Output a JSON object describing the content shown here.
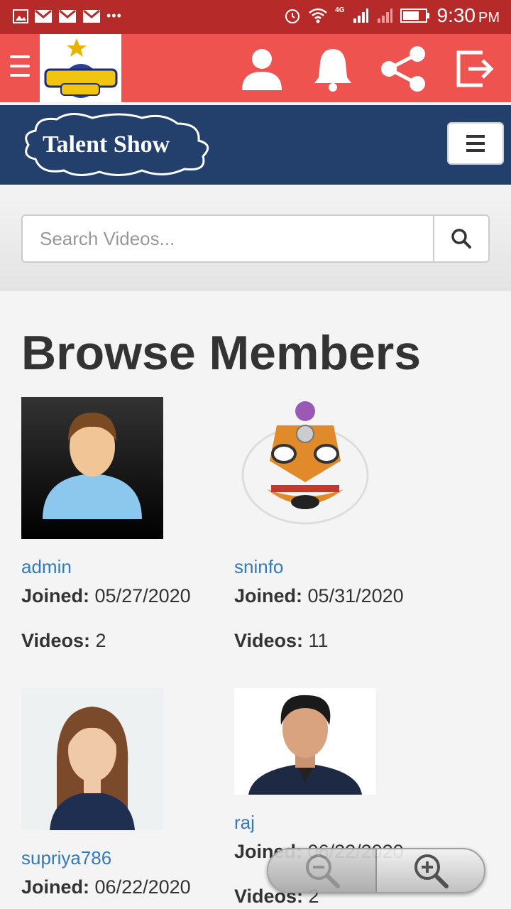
{
  "status_bar": {
    "time": "9:30",
    "ampm": "PM",
    "network": "4G"
  },
  "app_bar": {
    "brand": "Talent Show"
  },
  "site_header": {
    "brand": "Talent Show"
  },
  "search": {
    "placeholder": "Search Videos..."
  },
  "page": {
    "title": "Browse Members"
  },
  "labels": {
    "joined": "Joined:",
    "videos": "Videos:"
  },
  "members": [
    {
      "name": "admin",
      "joined": "05/27/2020",
      "videos": "2"
    },
    {
      "name": "sninfo",
      "joined": "05/31/2020",
      "videos": "11"
    },
    {
      "name": "supriya786",
      "joined": "06/22/2020",
      "videos": ""
    },
    {
      "name": "raj",
      "joined": "06/22/2020",
      "videos": "2"
    }
  ],
  "colors": {
    "status_bar": "#b72a2a",
    "app_bar": "#ef5350",
    "site_header": "#233f6b",
    "link": "#337ab7"
  }
}
